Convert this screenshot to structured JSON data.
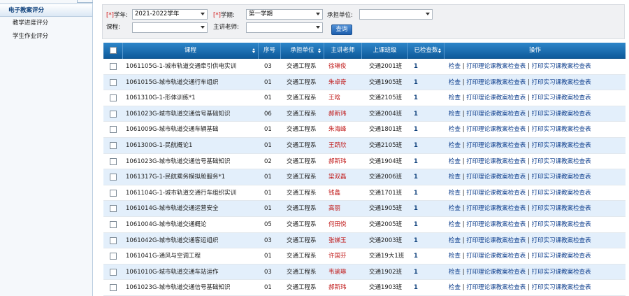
{
  "sidebar": {
    "items": [
      {
        "label": "电子教案评分",
        "active": true
      },
      {
        "label": "教学进度评分",
        "active": false
      },
      {
        "label": "学生作业评分",
        "active": false
      }
    ]
  },
  "filter": {
    "required_mark": "[*]",
    "year_label": "学年:",
    "year_value": "2021-2022学年",
    "term_label": "学期:",
    "term_value": "第一学期",
    "dept_label": "承担单位:",
    "dept_value": "",
    "course_label": "课程:",
    "course_value": "",
    "teacher_label": "主讲老师:",
    "teacher_value": "",
    "query_label": "查询"
  },
  "table": {
    "headers": {
      "course": "课程",
      "seq": "序号",
      "dept": "承担单位",
      "teacher": "主讲老师",
      "class": "上课班级",
      "count": "已检查数",
      "op": "操作"
    },
    "op_links": [
      "检查",
      "打印理论课教案检查表",
      "打印实习课教案检查表"
    ],
    "rows": [
      {
        "course": "1061105G-1-城市轨道交通牵引供电实训",
        "seq": "03",
        "dept": "交通工程系",
        "teacher": "徐琳俊",
        "class": "交通2001班",
        "count": "1"
      },
      {
        "course": "1061015G-城市轨道交通行车组织",
        "seq": "01",
        "dept": "交通工程系",
        "teacher": "朱卓奇",
        "class": "交通1905班",
        "count": "1"
      },
      {
        "course": "1061310G-1-形体训练*1",
        "seq": "01",
        "dept": "交通工程系",
        "teacher": "王晗",
        "class": "交通2105班",
        "count": "1"
      },
      {
        "course": "1061023G-城市轨道交通信号基础知识",
        "seq": "06",
        "dept": "交通工程系",
        "teacher": "郝新玮",
        "class": "交通2004班",
        "count": "1"
      },
      {
        "course": "1061009G-城市轨道交通车辆基础",
        "seq": "01",
        "dept": "交通工程系",
        "teacher": "朱海峰",
        "class": "交通1801班",
        "count": "1"
      },
      {
        "course": "1061300G-1-民航概论1",
        "seq": "01",
        "dept": "交通工程系",
        "teacher": "王跻欣",
        "class": "交通2105班",
        "count": "1"
      },
      {
        "course": "1061023G-城市轨道交通信号基础知识",
        "seq": "02",
        "dept": "交通工程系",
        "teacher": "郝新玮",
        "class": "交通1904班",
        "count": "1"
      },
      {
        "course": "1061317G-1-民航乘务模拟舱服务*1",
        "seq": "01",
        "dept": "交通工程系",
        "teacher": "梁双磊",
        "class": "交通2006班",
        "count": "1"
      },
      {
        "course": "1061104G-1-城市轨道交通行车组织实训",
        "seq": "01",
        "dept": "交通工程系",
        "teacher": "钱蠡",
        "class": "交通1701班",
        "count": "1"
      },
      {
        "course": "1061014G-城市轨道交通运营安全",
        "seq": "01",
        "dept": "交通工程系",
        "teacher": "高丽",
        "class": "交通1905班",
        "count": "1"
      },
      {
        "course": "1061004G-城市轨道交通概论",
        "seq": "05",
        "dept": "交通工程系",
        "teacher": "何田悦",
        "class": "交通2005班",
        "count": "1"
      },
      {
        "course": "1061042G-城市轨道交通客运组织",
        "seq": "03",
        "dept": "交通工程系",
        "teacher": "张娣玉",
        "class": "交通2003班",
        "count": "1"
      },
      {
        "course": "1061041G-通风与空调工程",
        "seq": "01",
        "dept": "交通工程系",
        "teacher": "许国芬",
        "class": "交通19大1班",
        "count": "1"
      },
      {
        "course": "1061010G-城市轨道交通车站运作",
        "seq": "03",
        "dept": "交通工程系",
        "teacher": "韦瑜琳",
        "class": "交通1902班",
        "count": "1"
      },
      {
        "course": "1061023G-城市轨道交通信号基础知识",
        "seq": "01",
        "dept": "交通工程系",
        "teacher": "郝新玮",
        "class": "交通1903班",
        "count": "1"
      }
    ]
  }
}
